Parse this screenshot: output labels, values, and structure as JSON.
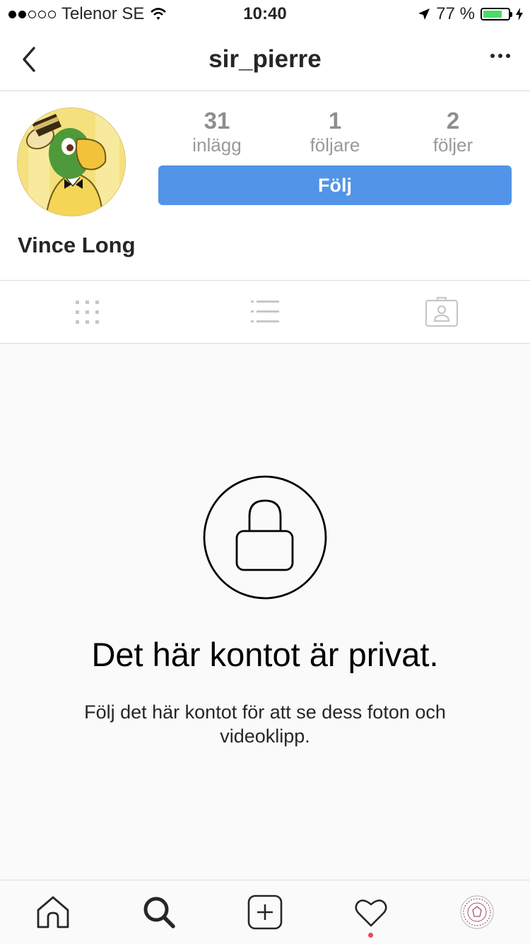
{
  "status_bar": {
    "carrier": "Telenor SE",
    "time": "10:40",
    "battery": "77 %",
    "battery_level": 0.77,
    "signal_bars": 2
  },
  "navbar": {
    "username": "sir_pierre"
  },
  "profile": {
    "full_name": "Vince Long",
    "stats": [
      {
        "value": "31",
        "label": "inlägg"
      },
      {
        "value": "1",
        "label": "följare"
      },
      {
        "value": "2",
        "label": "följer"
      }
    ],
    "follow_label": "Följ",
    "follow_color": "#5294e8"
  },
  "tabs": [
    "grid-icon",
    "list-icon",
    "tagged-icon"
  ],
  "private": {
    "title": "Det här kontot är privat.",
    "description": "Följ det här kontot för att se dess foton och videoklipp."
  },
  "tabbar": {
    "icons": [
      "home-icon",
      "search-icon",
      "add-icon",
      "heart-icon",
      "profile-avatar"
    ],
    "notification_color": "#ed4956"
  }
}
